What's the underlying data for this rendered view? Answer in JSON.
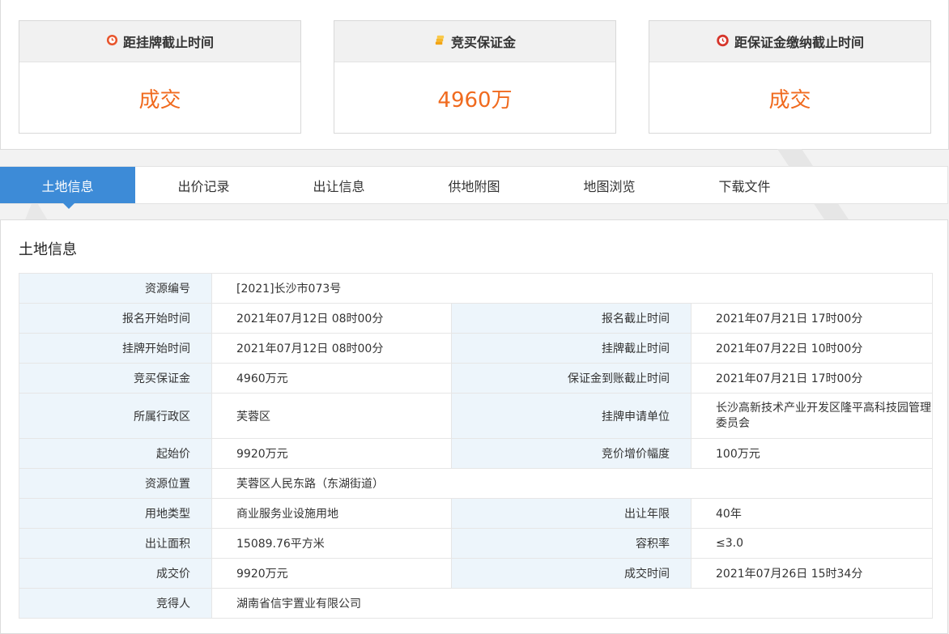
{
  "cards": [
    {
      "title": "距挂牌截止时间",
      "value": "成交",
      "icon": "clock-icon"
    },
    {
      "title": "竞买保证金",
      "value": "4960万",
      "icon": "coins-icon"
    },
    {
      "title": "距保证金缴纳截止时间",
      "value": "成交",
      "icon": "alarm-icon"
    }
  ],
  "tabs": [
    "土地信息",
    "出价记录",
    "出让信息",
    "供地附图",
    "地图浏览",
    "下载文件"
  ],
  "active_tab": "土地信息",
  "panel_title": "土地信息",
  "rows": {
    "r1": {
      "l1": "资源编号",
      "v1": "[2021]长沙市073号"
    },
    "r2": {
      "l1": "报名开始时间",
      "v1": "2021年07月12日 08时00分",
      "l2": "报名截止时间",
      "v2": "2021年07月21日 17时00分"
    },
    "r3": {
      "l1": "挂牌开始时间",
      "v1": "2021年07月12日 08时00分",
      "l2": "挂牌截止时间",
      "v2": "2021年07月22日 10时00分"
    },
    "r4": {
      "l1": "竞买保证金",
      "v1": "4960万元",
      "l2": "保证金到账截止时间",
      "v2": "2021年07月21日 17时00分"
    },
    "r5": {
      "l1": "所属行政区",
      "v1": "芙蓉区",
      "l2": "挂牌申请单位",
      "v2": "长沙高新技术产业开发区隆平高科技园管理委员会"
    },
    "r6": {
      "l1": "起始价",
      "v1": "9920万元",
      "l2": "竞价增价幅度",
      "v2": "100万元"
    },
    "r7": {
      "l1": "资源位置",
      "v1": "芙蓉区人民东路（东湖街道）"
    },
    "r8": {
      "l1": "用地类型",
      "v1": "商业服务业设施用地",
      "l2": "出让年限",
      "v2": "40年"
    },
    "r9": {
      "l1": "出让面积",
      "v1": "15089.76平方米",
      "l2": "容积率",
      "v2": "≤3.0"
    },
    "r10": {
      "l1": "成交价",
      "v1": "9920万元",
      "l2": "成交时间",
      "v2": "2021年07月26日 15时34分"
    },
    "r11": {
      "l1": "竞得人",
      "v1": "湖南省信宇置业有限公司"
    }
  },
  "colors": {
    "accent": "#3d8bd7",
    "value_orange": "#f06a1e",
    "label_bg": "#edf5fb"
  }
}
